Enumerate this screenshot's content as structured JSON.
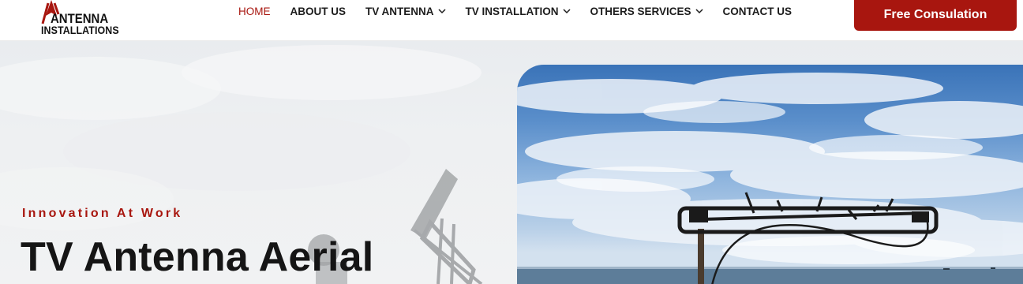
{
  "brand": {
    "line1": "ANTENNA",
    "line2": "INSTALLATIONS",
    "accent": "#a8160f"
  },
  "nav": {
    "items": [
      {
        "label": "HOME",
        "active": true,
        "has_dropdown": false
      },
      {
        "label": "ABOUT US",
        "active": false,
        "has_dropdown": false
      },
      {
        "label": "TV ANTENNA",
        "active": false,
        "has_dropdown": true
      },
      {
        "label": "TV INSTALLATION",
        "active": false,
        "has_dropdown": true
      },
      {
        "label": "OTHERS SERVICES",
        "active": false,
        "has_dropdown": true
      },
      {
        "label": "CONTACT US",
        "active": false,
        "has_dropdown": false
      }
    ]
  },
  "cta": {
    "label": "Free Consulation"
  },
  "hero": {
    "eyebrow": "Innovation At Work",
    "title": "TV Antenna Aerial"
  },
  "colors": {
    "primary": "#a8160f",
    "text": "#151515",
    "sky": "#5b8fcb"
  }
}
